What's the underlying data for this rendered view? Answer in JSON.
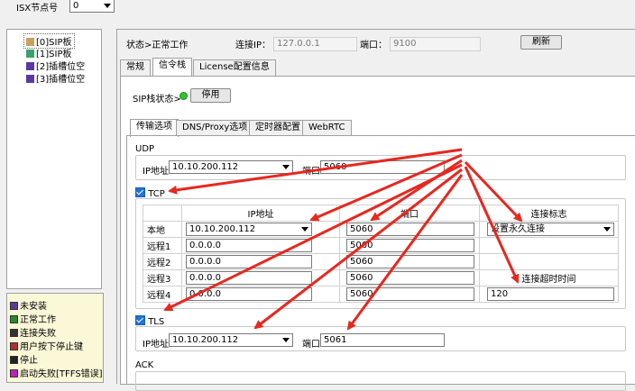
{
  "top": {
    "node_label": "ISX节点号",
    "node_value": "0"
  },
  "tree": {
    "items": [
      {
        "label": "[0]SIP板",
        "color": "#c8a060"
      },
      {
        "label": "[1]SIP板",
        "color": "#3aa070"
      },
      {
        "label": "[2]插槽位空",
        "color": "#5a3aa0"
      },
      {
        "label": "[3]插槽位空",
        "color": "#5a3aa0"
      }
    ]
  },
  "legend": {
    "items": [
      {
        "label": "未安装",
        "color": "#5a3aa0"
      },
      {
        "label": "正常工作",
        "color": "#2a8a2a"
      },
      {
        "label": "连接失败",
        "color": "#333333"
      },
      {
        "label": "用户按下停止键",
        "color": "#b03030"
      },
      {
        "label": "停止",
        "color": "#222222"
      },
      {
        "label": "启动失败[TFFS错误]",
        "color": "#c020c0"
      }
    ]
  },
  "status": {
    "state_label": "状态>",
    "state_value": "正常工作",
    "ip_label": "连接IP：",
    "ip_value": "127.0.0.1",
    "port_label": "端口：",
    "port_value": "9100",
    "refresh": "刷新"
  },
  "main_tabs": [
    "常规",
    "信令栈",
    "License配置信息"
  ],
  "sip": {
    "state_label": "SIP栈状态>",
    "stop": "停用"
  },
  "sub_tabs": [
    "传输选项",
    "DNS/Proxy选项",
    "定时器配置",
    "WebRTC"
  ],
  "udp": {
    "title": "UDP",
    "ip_label": "IP地址",
    "ip_value": "10.10.200.112",
    "port_label": "端口",
    "port_value": "5060"
  },
  "tcp": {
    "title": "TCP",
    "headers": [
      "IP地址",
      "端口",
      "连接标志"
    ],
    "rows": [
      {
        "name": "本地",
        "ip": "10.10.200.112",
        "port": "5060"
      },
      {
        "name": "远程1",
        "ip": "0.0.0.0",
        "port": "5060"
      },
      {
        "name": "远程2",
        "ip": "0.0.0.0",
        "port": "5060"
      },
      {
        "name": "远程3",
        "ip": "0.0.0.0",
        "port": "5060"
      },
      {
        "name": "远程4",
        "ip": "0.0.0.0",
        "port": "5060"
      }
    ],
    "conn_flag_value": "设置永久连接",
    "timeout_label": "连接超时时间",
    "timeout_value": "120"
  },
  "tls": {
    "title": "TLS",
    "ip_label": "IP地址",
    "ip_value": "10.10.200.112",
    "port_label": "端口",
    "port_value": "5061"
  },
  "ack": {
    "title": "ACK"
  },
  "colors": {
    "arrow": "#e8271f",
    "green_dot": "#2ec52e"
  }
}
